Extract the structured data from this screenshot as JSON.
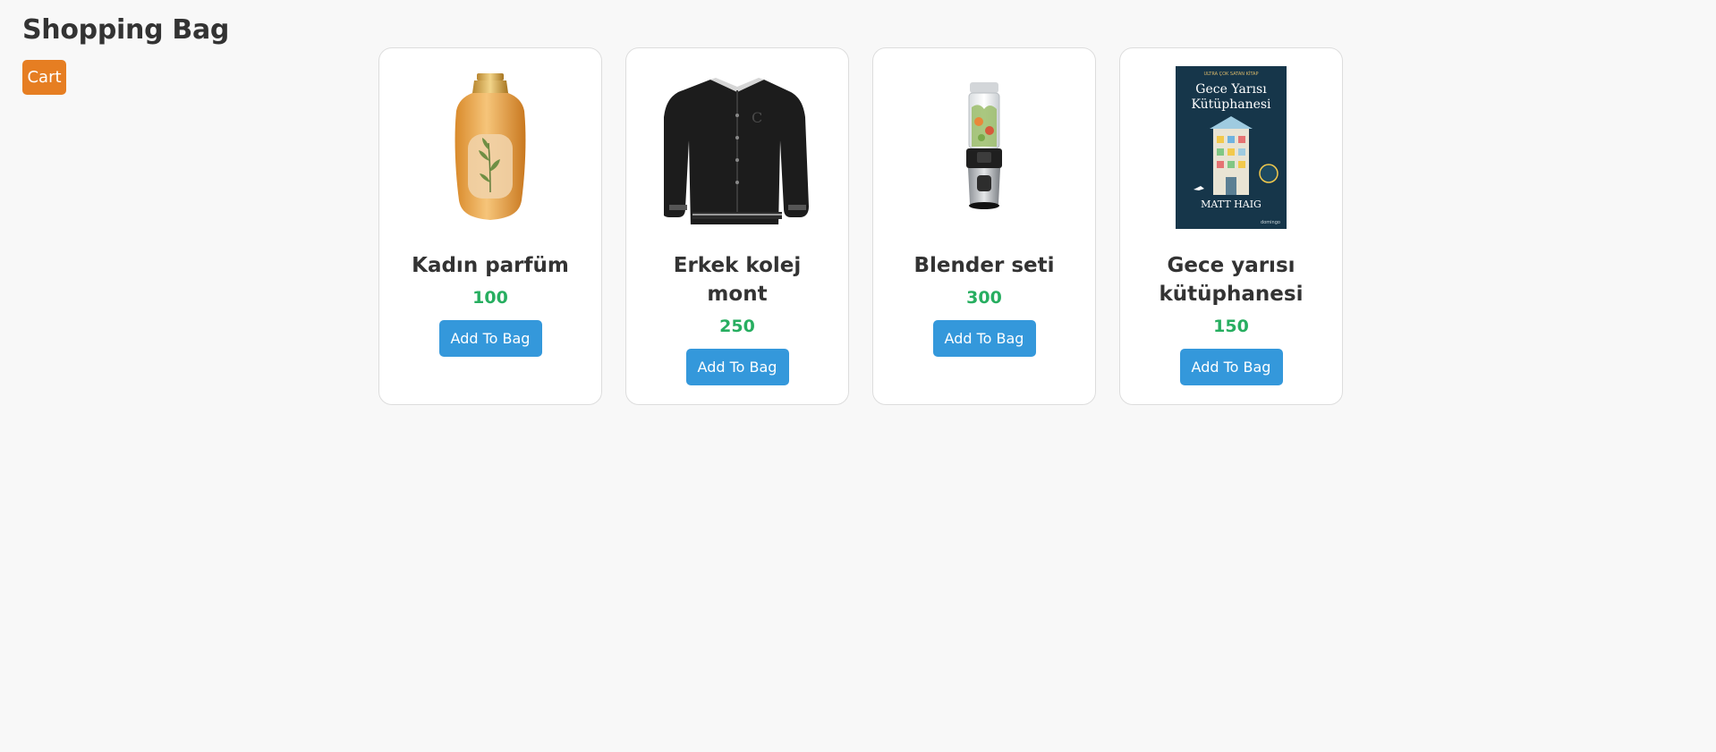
{
  "header": {
    "title": "Shopping Bag",
    "cart_label": "Cart"
  },
  "colors": {
    "background": "#f8f8f8",
    "cart_button": "#e67e22",
    "add_button": "#3498db",
    "price": "#27ae60",
    "text": "#333333"
  },
  "products": [
    {
      "name": "Kadın parfüm",
      "price": "100",
      "button_label": "Add To Bag",
      "image": "perfume-bottle-image"
    },
    {
      "name": "Erkek kolej mont",
      "price": "250",
      "button_label": "Add To Bag",
      "image": "varsity-jacket-image"
    },
    {
      "name": "Blender seti",
      "price": "300",
      "button_label": "Add To Bag",
      "image": "blender-image"
    },
    {
      "name": "Gece yarısı kütüphanesi",
      "price": "150",
      "button_label": "Add To Bag",
      "image": "book-cover-image",
      "cover": {
        "top_line": "ULTRA ÇOK SATAN KİTAP",
        "title_line1": "Gece Yarısı",
        "title_line2": "Kütüphanesi",
        "author": "MATT HAIG",
        "publisher": "domingo"
      }
    }
  ]
}
